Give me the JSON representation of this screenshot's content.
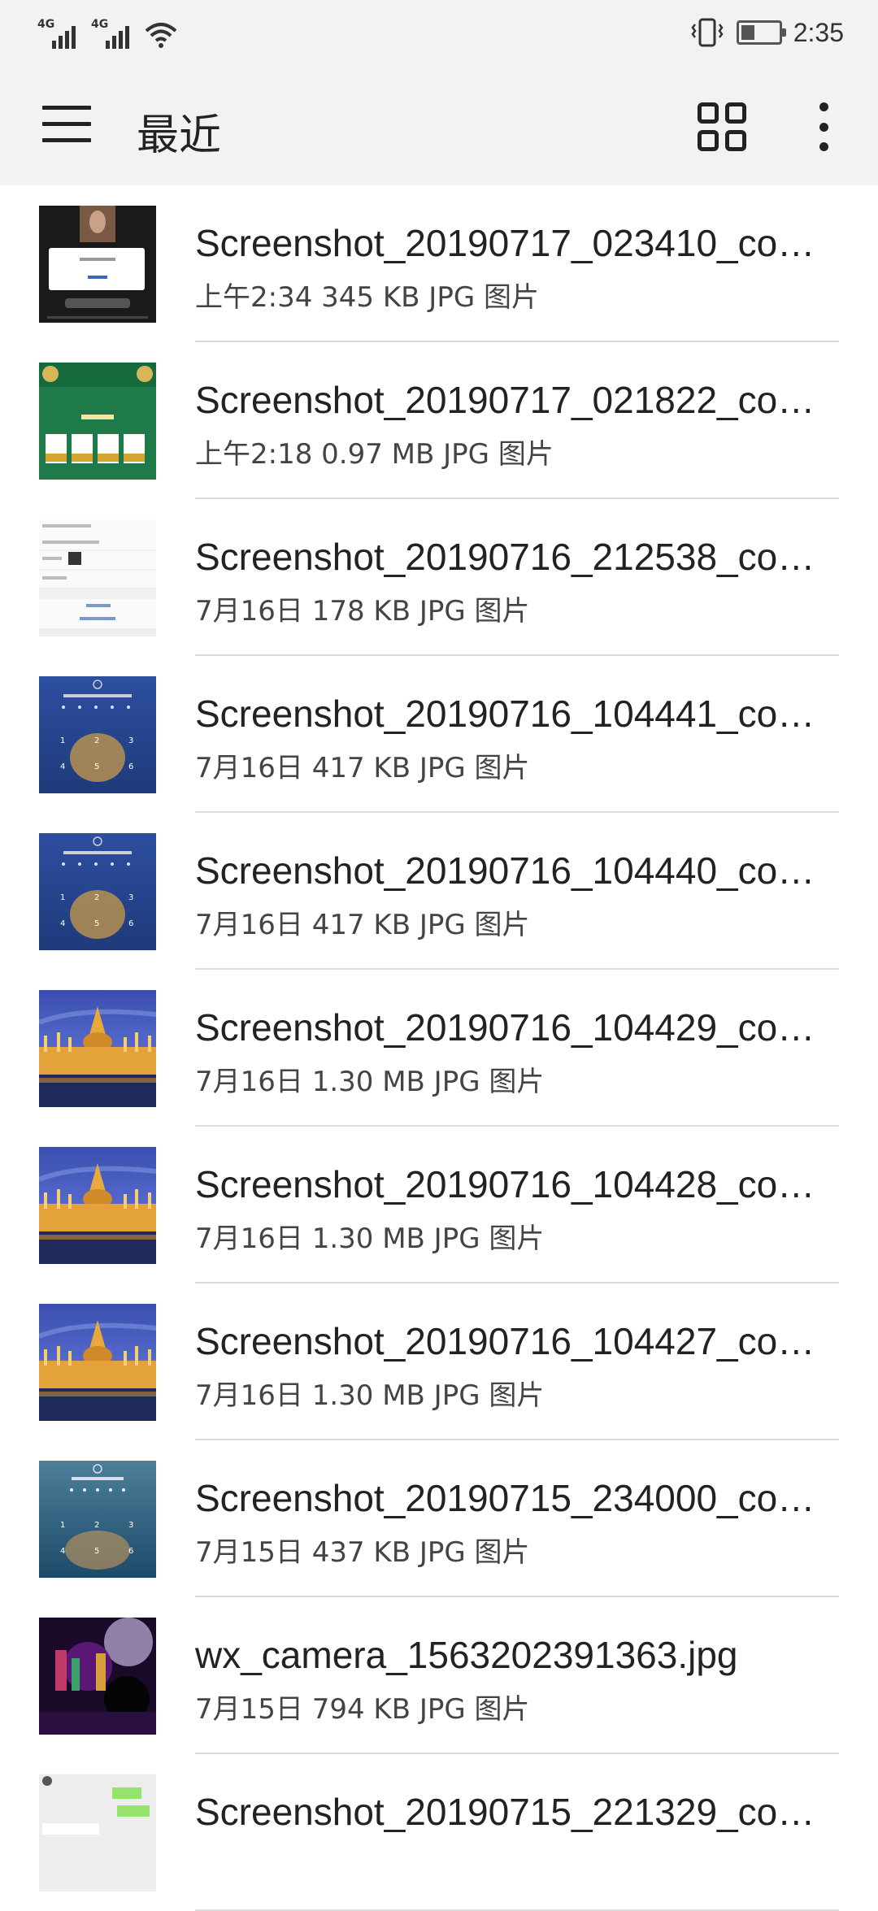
{
  "status_bar": {
    "signal1": "4G",
    "signal2": "4G",
    "time": "2:35"
  },
  "toolbar": {
    "title": "最近",
    "menu_icon": "hamburger-menu-icon",
    "grid_icon": "grid-view-icon",
    "more_icon": "more-vertical-icon"
  },
  "files": [
    {
      "name": "Screenshot_20190717_023410_co…",
      "meta": "上午2:34 345 KB JPG 图片",
      "thumb": "dialog"
    },
    {
      "name": "Screenshot_20190717_021822_co…",
      "meta": "上午2:18 0.97 MB JPG 图片",
      "thumb": "cards"
    },
    {
      "name": "Screenshot_20190716_212538_co…",
      "meta": "7月16日 178 KB JPG 图片",
      "thumb": "settings"
    },
    {
      "name": "Screenshot_20190716_104441_co…",
      "meta": "7月16日 417 KB JPG 图片",
      "thumb": "keypad"
    },
    {
      "name": "Screenshot_20190716_104440_co…",
      "meta": "7月16日 417 KB JPG 图片",
      "thumb": "keypad"
    },
    {
      "name": "Screenshot_20190716_104429_co…",
      "meta": "7月16日 1.30 MB JPG 图片",
      "thumb": "parliament"
    },
    {
      "name": "Screenshot_20190716_104428_co…",
      "meta": "7月16日 1.30 MB JPG 图片",
      "thumb": "parliament"
    },
    {
      "name": "Screenshot_20190716_104427_co…",
      "meta": "7月16日 1.30 MB JPG 图片",
      "thumb": "parliament"
    },
    {
      "name": "Screenshot_20190715_234000_co…",
      "meta": "7月15日 437 KB JPG 图片",
      "thumb": "keypad2"
    },
    {
      "name": "wx_camera_1563202391363.jpg",
      "meta": "7月15日 794 KB JPG 图片",
      "thumb": "party"
    },
    {
      "name": "Screenshot_20190715_221329_co…",
      "meta": "",
      "thumb": "chat"
    }
  ]
}
